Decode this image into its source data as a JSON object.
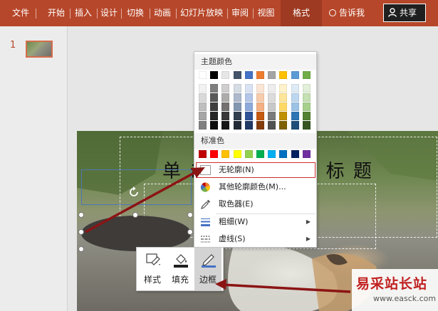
{
  "ribbon": {
    "tabs": [
      "文件",
      "开始",
      "插入",
      "设计",
      "切换",
      "动画",
      "幻灯片放映",
      "审阅",
      "视图",
      "格式"
    ],
    "active_tab": "格式",
    "tell_me": "告诉我",
    "share": "共享",
    "bg_color": "#b7472a"
  },
  "slides_pane": {
    "slide_number": "1"
  },
  "slide": {
    "title_text": "单 击 此 处 添 加 标 题"
  },
  "color_menu": {
    "theme_header": "主题颜色",
    "standard_header": "标准色",
    "theme_top_row": [
      "#ffffff",
      "#000000",
      "#e7e6e6",
      "#44546a",
      "#4472c4",
      "#ed7d31",
      "#a5a5a5",
      "#ffc000",
      "#5b9bd5",
      "#70ad47"
    ],
    "theme_shades": [
      [
        "#f2f2f2",
        "#d9d9d9",
        "#bfbfbf",
        "#a6a6a6",
        "#808080"
      ],
      [
        "#7f7f7f",
        "#595959",
        "#404040",
        "#262626",
        "#0d0d0d"
      ],
      [
        "#d0cece",
        "#aeabab",
        "#757171",
        "#3a3838",
        "#171616"
      ],
      [
        "#d6dce4",
        "#adb9ca",
        "#8497b0",
        "#333f4f",
        "#222a35"
      ],
      [
        "#d9e2f3",
        "#b4c6e7",
        "#8eaadb",
        "#2f5496",
        "#1f3864"
      ],
      [
        "#fbe5d5",
        "#f7cbac",
        "#f4b183",
        "#c55a11",
        "#833c0b"
      ],
      [
        "#ededed",
        "#dbdbdb",
        "#c9c9c9",
        "#7b7b7b",
        "#525252"
      ],
      [
        "#fff2cc",
        "#fee599",
        "#ffd965",
        "#bf9000",
        "#7f6000"
      ],
      [
        "#deebf6",
        "#bdd7ee",
        "#9cc3e5",
        "#2e75b5",
        "#1e4e79"
      ],
      [
        "#e2efd9",
        "#c5e0b3",
        "#a8d08d",
        "#538135",
        "#375623"
      ]
    ],
    "standard_colors": [
      "#c00000",
      "#ff0000",
      "#ffc000",
      "#ffff00",
      "#92d050",
      "#00b050",
      "#00b0f0",
      "#0070c0",
      "#002060",
      "#7030a0"
    ],
    "items": [
      {
        "label": "无轮廓(N)",
        "icon": "no-outline-icon"
      },
      {
        "label": "其他轮廓颜色(M)...",
        "icon": "color-wheel-icon"
      },
      {
        "label": "取色器(E)",
        "icon": "eyedropper-icon"
      },
      {
        "label": "粗细(W)",
        "icon": "line-weight-icon",
        "submenu": true
      },
      {
        "label": "虚线(S)",
        "icon": "dash-icon",
        "submenu": true
      }
    ]
  },
  "mini_toolbar": {
    "buttons": [
      {
        "label": "样式",
        "icon": "style-icon"
      },
      {
        "label": "填充",
        "icon": "fill-bucket-icon"
      },
      {
        "label": "边框",
        "icon": "outline-pen-icon",
        "active": true
      }
    ]
  },
  "watermark": {
    "text": "易采站长站",
    "url": "www.easck.com"
  }
}
